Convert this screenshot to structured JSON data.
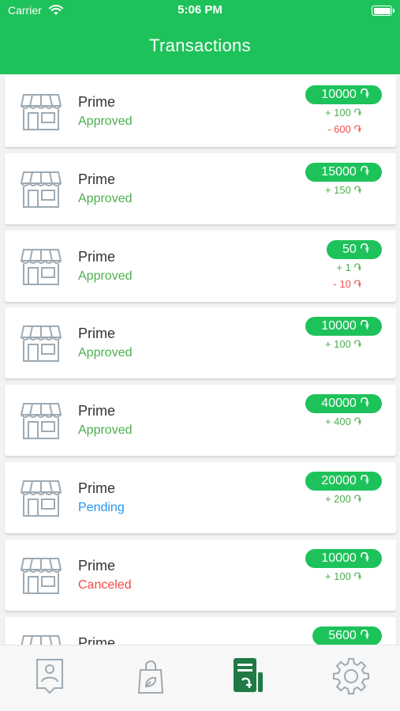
{
  "status_bar": {
    "carrier": "Carrier",
    "time": "5:06 PM"
  },
  "header": {
    "title": "Transactions"
  },
  "currency_symbol": "֏",
  "colors": {
    "accent": "#1ec25a",
    "approved": "#4caf50",
    "pending": "#2196f3",
    "canceled": "#f04848",
    "icon": "#9eaab3"
  },
  "transactions": [
    {
      "merchant": "Prime",
      "status": "Approved",
      "amount": "10000",
      "bonus": "+ 100",
      "deduction": "- 600"
    },
    {
      "merchant": "Prime",
      "status": "Approved",
      "amount": "15000",
      "bonus": "+ 150",
      "deduction": null
    },
    {
      "merchant": "Prime",
      "status": "Approved",
      "amount": "50",
      "bonus": "+ 1",
      "deduction": "- 10"
    },
    {
      "merchant": "Prime",
      "status": "Approved",
      "amount": "10000",
      "bonus": "+ 100",
      "deduction": null
    },
    {
      "merchant": "Prime",
      "status": "Approved",
      "amount": "40000",
      "bonus": "+ 400",
      "deduction": null
    },
    {
      "merchant": "Prime",
      "status": "Pending",
      "amount": "20000",
      "bonus": "+ 200",
      "deduction": null
    },
    {
      "merchant": "Prime",
      "status": "Canceled",
      "amount": "10000",
      "bonus": "+ 100",
      "deduction": null
    },
    {
      "merchant": "Prime",
      "status": "",
      "amount": "5600",
      "bonus": null,
      "deduction": null
    }
  ],
  "tabs": [
    {
      "name": "profile-icon",
      "active": false
    },
    {
      "name": "shopping-bag-icon",
      "active": false
    },
    {
      "name": "receipt-icon",
      "active": true
    },
    {
      "name": "gear-icon",
      "active": false
    }
  ]
}
